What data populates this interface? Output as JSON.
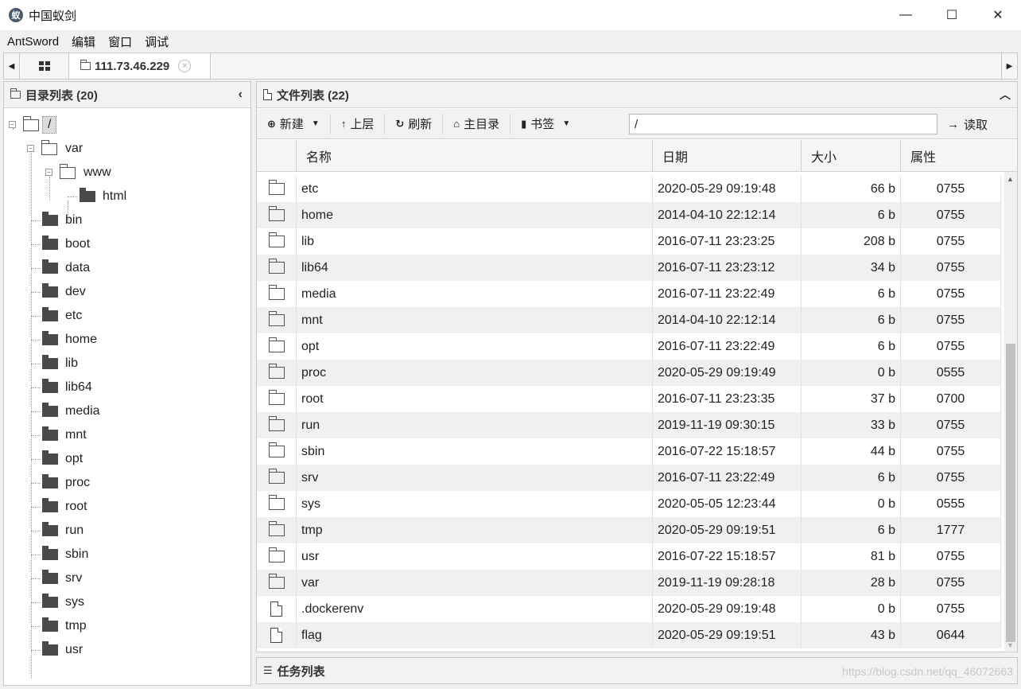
{
  "window": {
    "title": "中国蚁剑",
    "logo_glyph": "蚁",
    "minimize": "—",
    "maximize": "☐",
    "close": "✕"
  },
  "menu": [
    "AntSword",
    "编辑",
    "窗口",
    "调试"
  ],
  "tabs": {
    "host": "111.73.46.229",
    "close_glyph": "✕",
    "left_arrow": "◀",
    "right_arrow": "▶"
  },
  "dir_panel": {
    "title": "目录列表 (20)",
    "collapse_glyph": "‹",
    "root": "/",
    "var_children": {
      "www": "www",
      "html": "html"
    },
    "items": [
      "var",
      "bin",
      "boot",
      "data",
      "dev",
      "etc",
      "home",
      "lib",
      "lib64",
      "media",
      "mnt",
      "opt",
      "proc",
      "root",
      "run",
      "sbin",
      "srv",
      "sys",
      "tmp",
      "usr"
    ]
  },
  "file_panel": {
    "title": "文件列表 (22)",
    "expand_glyph": "︿",
    "toolbar": {
      "new_label": "新建",
      "up_label": "上层",
      "refresh_label": "刷新",
      "home_label": "主目录",
      "bookmark_label": "书签",
      "path_value": "/",
      "read_label": "读取"
    },
    "columns": {
      "name": "名称",
      "date": "日期",
      "size": "大小",
      "attr": "属性"
    },
    "rows": [
      {
        "type": "folder",
        "name": "etc",
        "date": "2020-05-29 09:19:48",
        "size": "66 b",
        "attr": "0755"
      },
      {
        "type": "folder",
        "name": "home",
        "date": "2014-04-10 22:12:14",
        "size": "6 b",
        "attr": "0755"
      },
      {
        "type": "folder",
        "name": "lib",
        "date": "2016-07-11 23:23:25",
        "size": "208 b",
        "attr": "0755"
      },
      {
        "type": "folder",
        "name": "lib64",
        "date": "2016-07-11 23:23:12",
        "size": "34 b",
        "attr": "0755"
      },
      {
        "type": "folder",
        "name": "media",
        "date": "2016-07-11 23:22:49",
        "size": "6 b",
        "attr": "0755"
      },
      {
        "type": "folder",
        "name": "mnt",
        "date": "2014-04-10 22:12:14",
        "size": "6 b",
        "attr": "0755"
      },
      {
        "type": "folder",
        "name": "opt",
        "date": "2016-07-11 23:22:49",
        "size": "6 b",
        "attr": "0755"
      },
      {
        "type": "folder",
        "name": "proc",
        "date": "2020-05-29 09:19:49",
        "size": "0 b",
        "attr": "0555"
      },
      {
        "type": "folder",
        "name": "root",
        "date": "2016-07-11 23:23:35",
        "size": "37 b",
        "attr": "0700"
      },
      {
        "type": "folder",
        "name": "run",
        "date": "2019-11-19 09:30:15",
        "size": "33 b",
        "attr": "0755"
      },
      {
        "type": "folder",
        "name": "sbin",
        "date": "2016-07-22 15:18:57",
        "size": "44 b",
        "attr": "0755"
      },
      {
        "type": "folder",
        "name": "srv",
        "date": "2016-07-11 23:22:49",
        "size": "6 b",
        "attr": "0755"
      },
      {
        "type": "folder",
        "name": "sys",
        "date": "2020-05-05 12:23:44",
        "size": "0 b",
        "attr": "0555"
      },
      {
        "type": "folder",
        "name": "tmp",
        "date": "2020-05-29 09:19:51",
        "size": "6 b",
        "attr": "1777"
      },
      {
        "type": "folder",
        "name": "usr",
        "date": "2016-07-22 15:18:57",
        "size": "81 b",
        "attr": "0755"
      },
      {
        "type": "folder",
        "name": "var",
        "date": "2019-11-19 09:28:18",
        "size": "28 b",
        "attr": "0755"
      },
      {
        "type": "file",
        "name": ".dockerenv",
        "date": "2020-05-29 09:19:48",
        "size": "0 b",
        "attr": "0755"
      },
      {
        "type": "file",
        "name": "flag",
        "date": "2020-05-29 09:19:51",
        "size": "43 b",
        "attr": "0644"
      }
    ]
  },
  "task_panel": {
    "title": "任务列表"
  },
  "watermark": "https://blog.csdn.net/qq_46072663"
}
